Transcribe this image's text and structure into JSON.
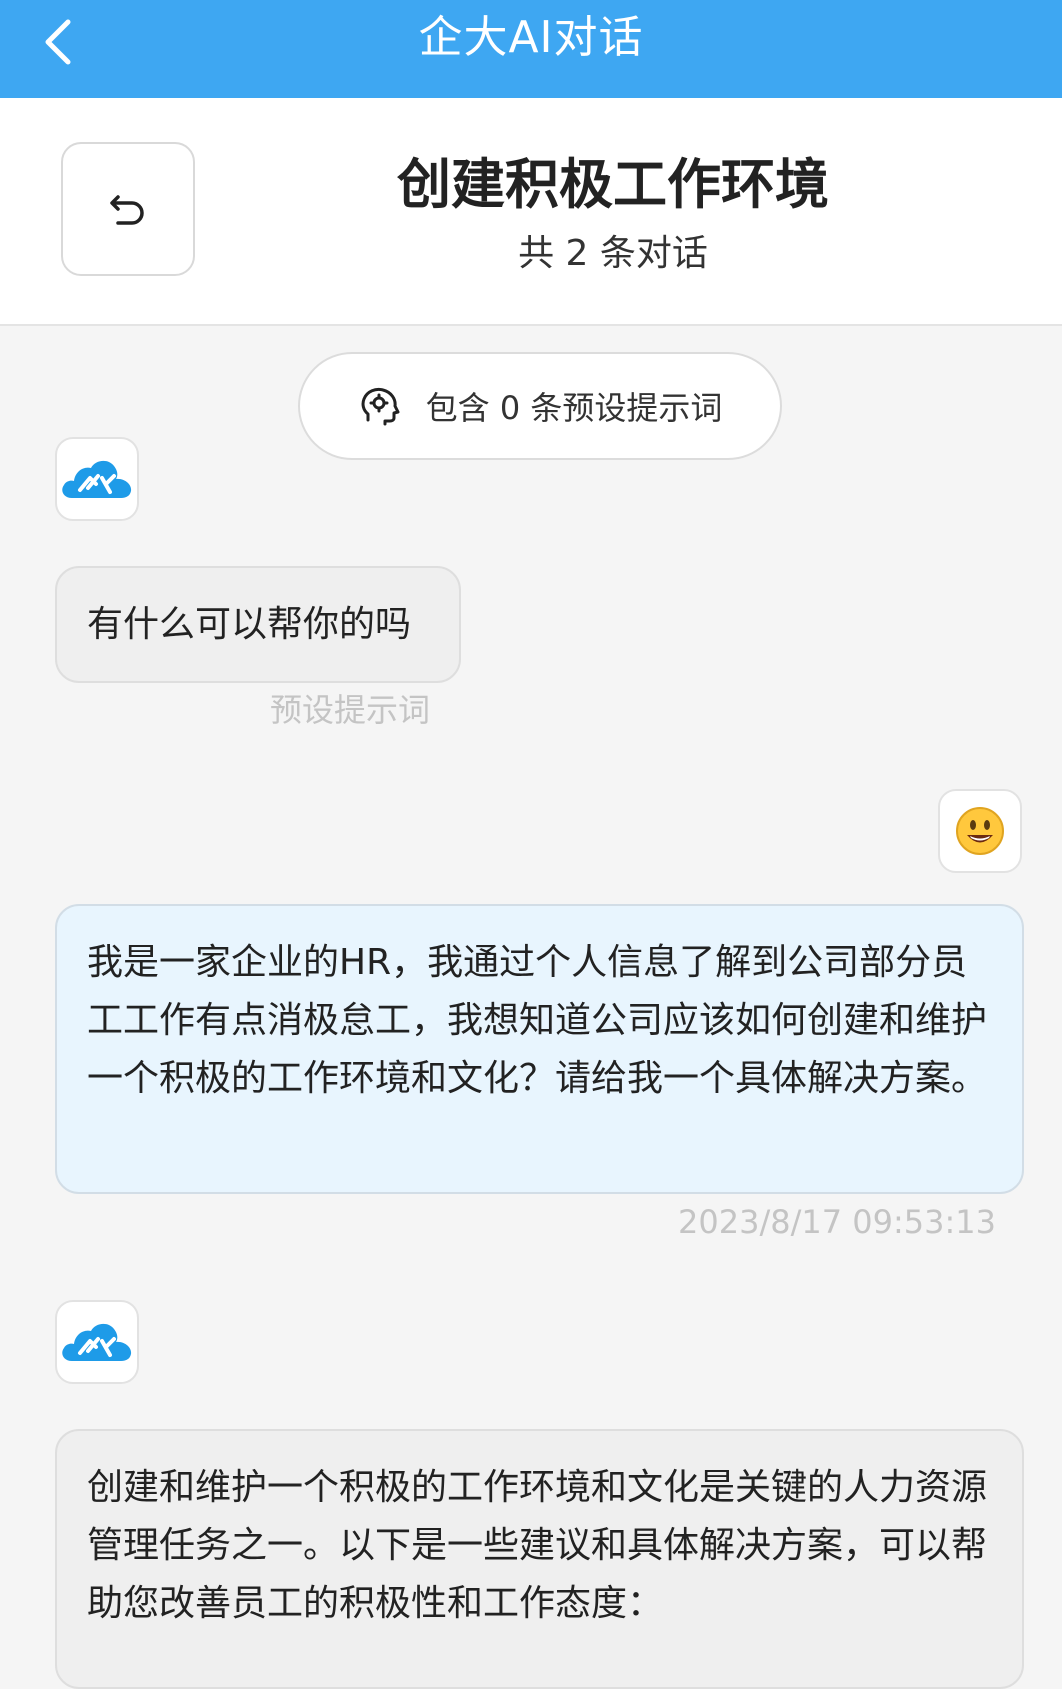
{
  "topbar": {
    "title": "企大AI对话"
  },
  "header": {
    "title": "创建积极工作环境",
    "subtitle": "共 2 条对话"
  },
  "prompt_pill": {
    "label": "包含 0 条预设提示词"
  },
  "messages": [
    {
      "role": "bot",
      "text": "有什么可以帮你的吗",
      "meta": "预设提示词"
    },
    {
      "role": "user",
      "text": "我是一家企业的HR，我通过个人信息了解到公司部分员工工作有点消极怠工，我想知道公司应该如何创建和维护一个积极的工作环境和文化？请给我一个具体解决方案。",
      "meta": "2023/8/17 09:53:13"
    },
    {
      "role": "bot",
      "text": "创建和维护一个积极的工作环境和文化是关键的人力资源管理任务之一。以下是一些建议和具体解决方案，可以帮助您改善员工的积极性和工作态度："
    }
  ],
  "colors": {
    "topbar": "#3ea7f2",
    "user_bubble": "#e8f5fe",
    "bot_bubble": "#efefef",
    "brand_logo": "#1e9be8"
  },
  "icons": {
    "back": "chevron-left-icon",
    "undo": "undo-arrow-icon",
    "prompt": "head-brain-icon",
    "bot_avatar": "cloud-logo-icon",
    "user_avatar": "smiley-face-icon"
  }
}
